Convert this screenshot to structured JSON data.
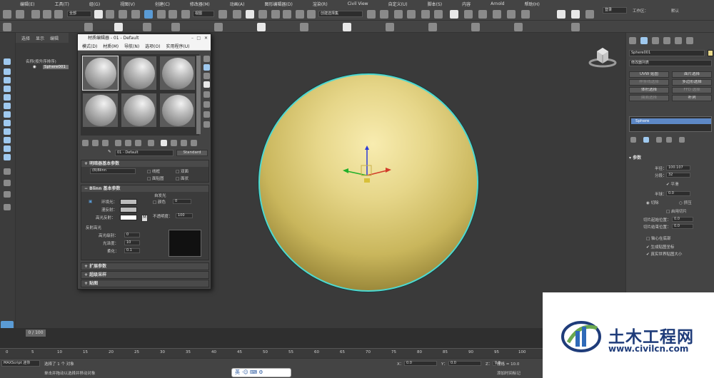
{
  "menu": [
    "编辑(E)",
    "工具(T)",
    "组(G)",
    "视图(V)",
    "创建(C)",
    "修改器(M)",
    "动画(A)",
    "图形编辑器(D)",
    "渲染(R)",
    "Civil View",
    "自定义(U)",
    "脚本(S)",
    "内容",
    "Arnold",
    "帮助(H)"
  ],
  "toolbar": {
    "selection_filter": "全部",
    "view_dropdown": "视图",
    "selection_set": "创建选择集",
    "login": "登录",
    "workspace_label": "工作区：",
    "workspace_value": "默认"
  },
  "scene_explorer": {
    "tabs": [
      "选择",
      "显示",
      "编辑"
    ],
    "sort_label": "名称(按升序排序)",
    "object": "Sphere001"
  },
  "material_editor": {
    "title": "材质编辑器 - 01 - Default",
    "menu": [
      "模式(D)",
      "材质(M)",
      "导航(N)",
      "选项(O)",
      "实用程序(U)"
    ],
    "material_name": "01 - Default",
    "material_type": "Standard",
    "shader_rollout": {
      "title": "明暗器基本参数",
      "shader": "(B)Blinn",
      "options": [
        "线框",
        "双面",
        "面贴图",
        "面状"
      ]
    },
    "blinn_rollout": {
      "title": "Blinn 基本参数",
      "self_illum_title": "自发光",
      "color_label": "颜色",
      "color_value": "0",
      "ambient": "环境光：",
      "diffuse": "漫反射：",
      "specular": "高光反射：",
      "opacity_label": "不透明度：",
      "opacity_value": "100",
      "specular_highlights": "反射高光",
      "spec_level_label": "高光级别：",
      "spec_level_value": "0",
      "glossiness_label": "光泽度：",
      "glossiness_value": "10",
      "soften_label": "柔化：",
      "soften_value": "0.1",
      "lock_button": "M"
    },
    "collapsed_rollouts": [
      "扩展参数",
      "超级采样",
      "贴图"
    ]
  },
  "command_panel": {
    "object_name": "Sphere001",
    "modifier_list": "修改器列表",
    "buttons": [
      {
        "label": "UVW 贴图",
        "dim": false
      },
      {
        "label": "面片选择",
        "dim": false
      },
      {
        "label": "样条线选择",
        "dim": true
      },
      {
        "label": "多边形选择",
        "dim": false
      },
      {
        "label": "体积选择",
        "dim": false
      },
      {
        "label": "FFD 选择",
        "dim": true
      },
      {
        "label": "曲面选择",
        "dim": true
      },
      {
        "label": "补洞",
        "dim": false
      }
    ],
    "stack_item": "Sphere",
    "params_title": "参数",
    "radius_label": "半径：",
    "radius_value": "100.107",
    "segments_label": "分段：",
    "segments_value": "32",
    "smooth_label": "平滑",
    "hemisphere_label": "半球：",
    "hemisphere_value": "0.0",
    "chop_label": "切除",
    "squash_label": "挤压",
    "slice_on_label": "启用切片",
    "slice_from_label": "切片起始位置：",
    "slice_from_value": "0.0",
    "slice_to_label": "切片结束位置：",
    "slice_to_value": "0.0",
    "base_pivot_label": "轴心在底部",
    "gen_mapping_label": "生成贴图坐标",
    "real_world_label": "真实世界贴图大小"
  },
  "timeline": {
    "frame_display": "0 / 100",
    "ticks": [
      "0",
      "5",
      "10",
      "15",
      "20",
      "25",
      "30",
      "35",
      "40",
      "45",
      "50",
      "55",
      "60",
      "65",
      "70",
      "75",
      "80",
      "85",
      "90",
      "95",
      "100"
    ]
  },
  "status": {
    "maxscript": "MAXScript 迷你",
    "selected": "选择了 1 个 对象",
    "hint": "单击并拖动以选择并移动对象",
    "x_label": "X：",
    "x_value": "0.0",
    "y_label": "Y：",
    "y_value": "0.0",
    "z_label": "Z：",
    "z_value": "0.0",
    "grid": "栅格 = 10.0",
    "add_time_tag": "添加时间标记",
    "ime": "英"
  },
  "watermark": {
    "title": "土木工程网",
    "url": "www.civilcn.com"
  },
  "colors": {
    "sphere": "#e6d689",
    "selection_outline": "#4fd8d0",
    "accent": "#5d88c6"
  }
}
